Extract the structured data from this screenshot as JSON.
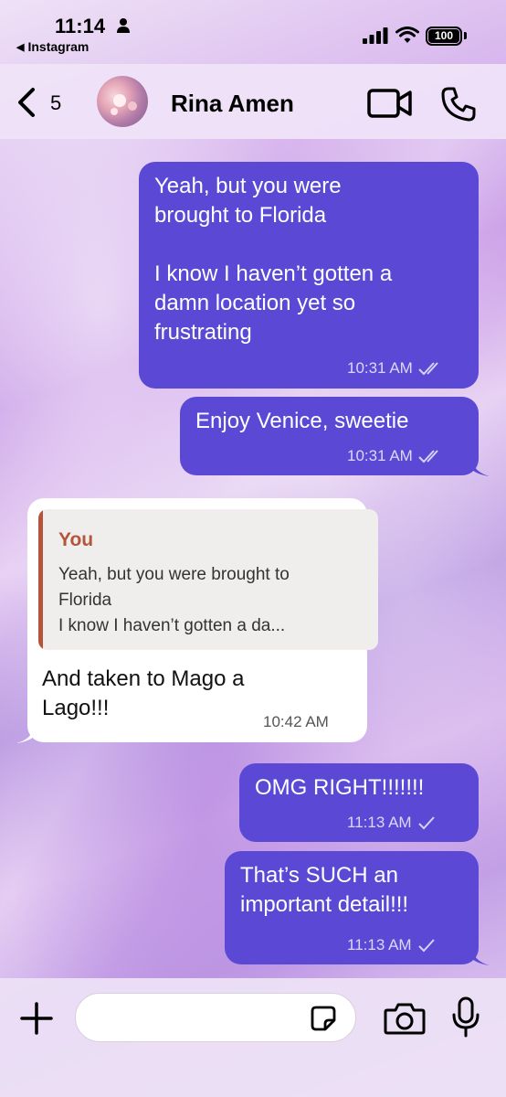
{
  "status_bar": {
    "time": "11:14",
    "back_app_label": "Instagram",
    "battery_percent": "100"
  },
  "header": {
    "unread_count": "5",
    "contact_name": "Rina Amen"
  },
  "messages": [
    {
      "direction": "outgoing",
      "text": "Yeah, but you were\nbrought to Florida\n\nI know I haven’t gotten a\ndamn location yet so\nfrustrating",
      "time": "10:31 AM",
      "status": "read"
    },
    {
      "direction": "outgoing",
      "text": "Enjoy Venice, sweetie",
      "time": "10:31 AM",
      "status": "read"
    },
    {
      "direction": "incoming",
      "quote_author": "You",
      "quote_text": "Yeah, but you were brought to\nFlorida\nI know I haven’t gotten a da...",
      "text": "And taken to Mago a\nLago!!!",
      "time": "10:42 AM"
    },
    {
      "direction": "outgoing",
      "text": "OMG RIGHT!!!!!!!",
      "time": "11:13 AM",
      "status": "delivered"
    },
    {
      "direction": "outgoing",
      "text": "That’s SUCH an\nimportant detail!!!",
      "time": "11:13 AM",
      "status": "delivered"
    }
  ],
  "composer": {
    "placeholder": ""
  },
  "colors": {
    "outgoing_bubble": "#5b48d5",
    "incoming_bubble": "#ffffff",
    "quote_accent": "#b4543a"
  },
  "icons": [
    "person-icon",
    "signal-icon",
    "wifi-icon",
    "battery-icon",
    "back-chevron-icon",
    "video-camera-icon",
    "phone-icon",
    "plus-icon",
    "sticker-icon",
    "camera-icon",
    "microphone-icon",
    "double-check-icon",
    "single-check-icon"
  ]
}
